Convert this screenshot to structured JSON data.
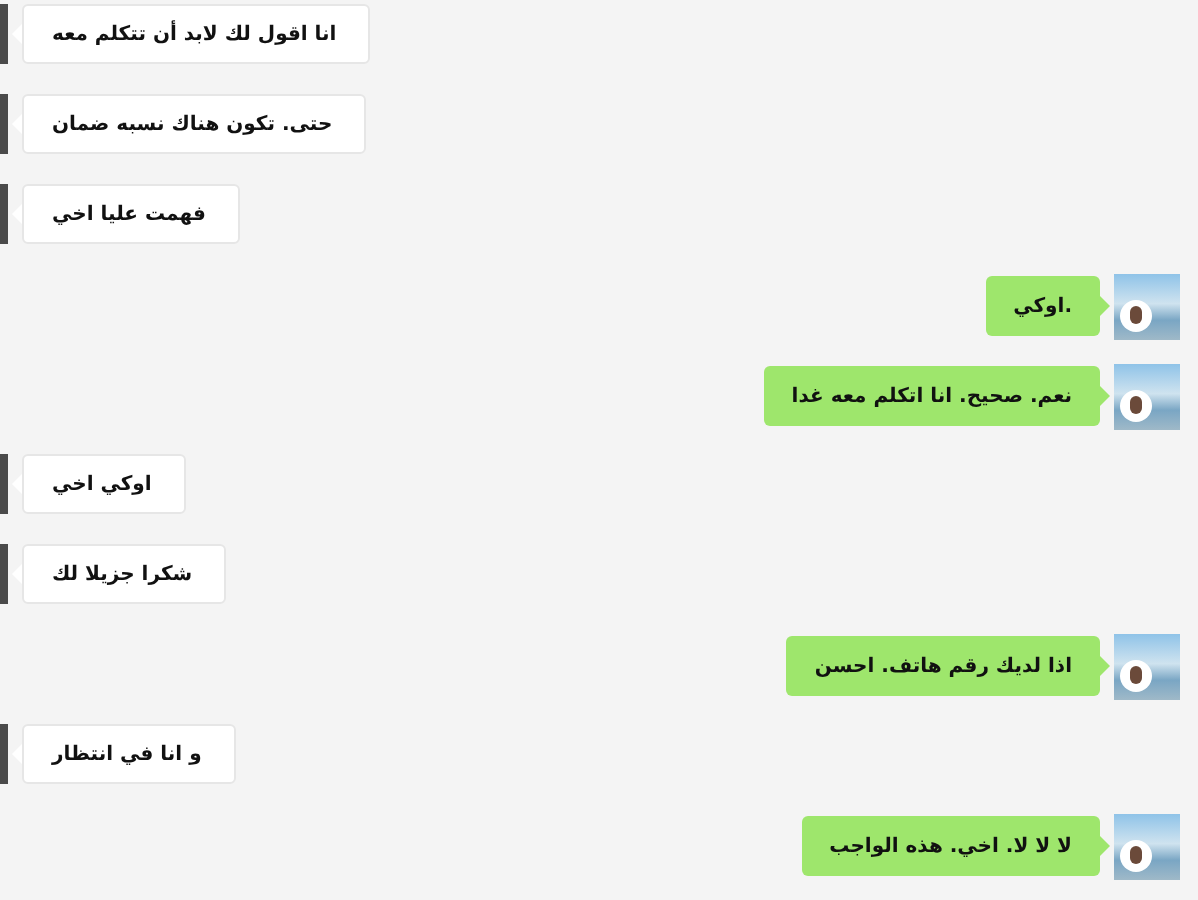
{
  "messages": [
    {
      "kind": "in",
      "text": "انا اقول لك لابد أن تتكلم معه"
    },
    {
      "kind": "in",
      "text": "حتى. تكون هناك نسبه ضمان"
    },
    {
      "kind": "in",
      "text": "فهمت عليا اخي"
    },
    {
      "kind": "out",
      "text": ".اوكي"
    },
    {
      "kind": "out",
      "text": "نعم. صحيح.  انا اتكلم معه غدا"
    },
    {
      "kind": "in",
      "text": "اوكي اخي"
    },
    {
      "kind": "in",
      "text": "شكرا جزيلا لك"
    },
    {
      "kind": "out",
      "text": "اذا لديك رقم هاتف. احسن"
    },
    {
      "kind": "in",
      "text": "و انا في انتظار"
    },
    {
      "kind": "out",
      "text": "لا لا لا. اخي. هذه الواجب"
    }
  ]
}
